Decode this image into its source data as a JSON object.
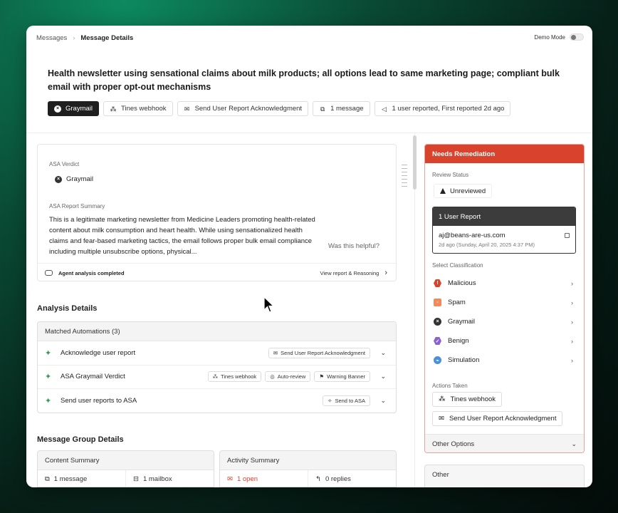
{
  "breadcrumb": {
    "parent": "Messages",
    "current": "Message Details"
  },
  "demo_mode": {
    "label": "Demo Mode"
  },
  "message": {
    "title": "Health newsletter using sensational claims about milk products; all options lead to same marketing page; compliant bulk email with proper opt-out mechanisms",
    "tags": [
      "Graymail",
      "Tines webhook",
      "Send User Report Acknowledgment",
      "1 message",
      "1 user reported, First reported 2d ago"
    ]
  },
  "verdict": {
    "label": "ASA Verdict",
    "value": "Graymail",
    "summary_label": "ASA Report Summary",
    "summary": "This is a legitimate marketing newsletter from Medicine Leaders promoting health-related content about milk consumption and heart health. While using sensationalized health claims and fear-based marketing tactics, the email follows proper bulk email compliance including multiple unsubscribe options, physical...",
    "helpful": "Was this helpful?",
    "agent_status": "Agent analysis completed",
    "view_link": "View report & Reasoning"
  },
  "analysis": {
    "title": "Analysis Details",
    "automations_header": "Matched Automations (3)",
    "automations": [
      {
        "label": "Acknowledge user report",
        "chips": [
          "Send User Report Acknowledgment"
        ]
      },
      {
        "label": "ASA Graymail Verdict",
        "chips": [
          "Tines webhook",
          "Auto-review",
          "Warning Banner"
        ]
      },
      {
        "label": "Send user reports to ASA",
        "chips": [
          "Send to ASA"
        ]
      }
    ]
  },
  "group": {
    "title": "Message Group Details",
    "content_summary": {
      "header": "Content Summary",
      "cells": [
        "1 message",
        "1 mailbox"
      ]
    },
    "activity_summary": {
      "header": "Activity Summary",
      "cells": [
        "1 open",
        "0 replies"
      ]
    }
  },
  "remediation": {
    "header": "Needs Remediation",
    "review_status_label": "Review Status",
    "review_status": "Unreviewed",
    "report_header": "1 User Report",
    "report_email": "aj@beans-are-us.com",
    "report_date": "2d ago (Sunday, April 20, 2025 4:37 PM)",
    "classification_label": "Select Classification",
    "classifications": [
      "Malicious",
      "Spam",
      "Graymail",
      "Benign",
      "Simulation"
    ],
    "actions_label": "Actions Taken",
    "actions": [
      "Tines webhook",
      "Send User Report Acknowledgment"
    ],
    "other_options": "Other Options"
  },
  "other": {
    "label": "Other"
  },
  "colors": {
    "accent_red": "#d9432d",
    "sparkle_green": "#3a9a5a",
    "open_red": "#d9432d"
  }
}
